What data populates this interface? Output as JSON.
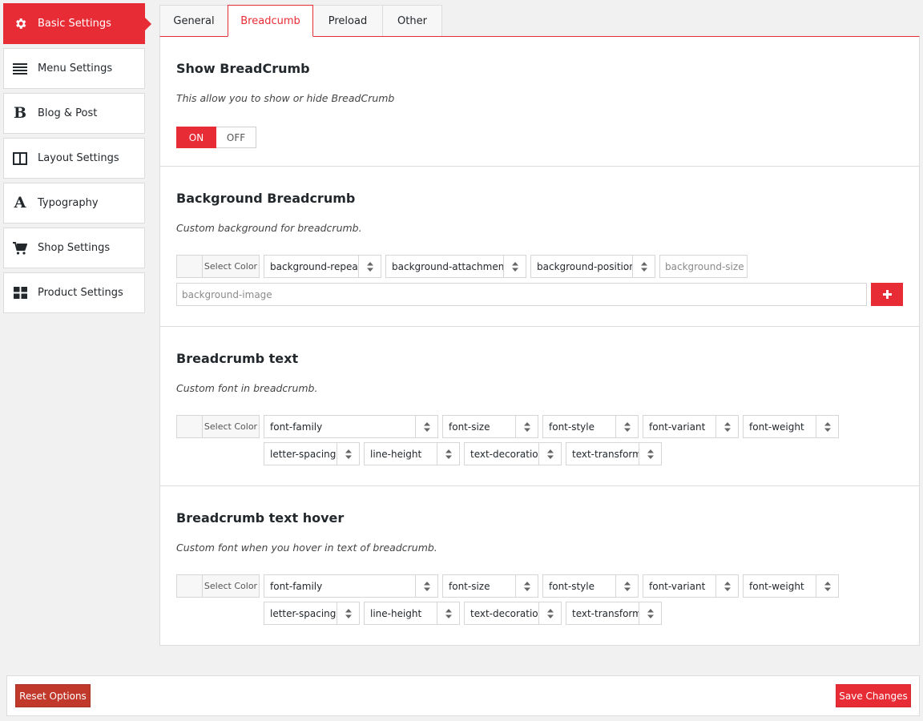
{
  "sidebar": {
    "items": [
      {
        "label": "Basic Settings",
        "icon": "gear-icon",
        "active": true
      },
      {
        "label": "Menu Settings",
        "icon": "menu-lines-icon"
      },
      {
        "label": "Blog & Post",
        "icon": "bold-b-icon",
        "glyph": "B"
      },
      {
        "label": "Layout Settings",
        "icon": "columns-icon"
      },
      {
        "label": "Typography",
        "icon": "font-a-icon",
        "glyph": "A"
      },
      {
        "label": "Shop Settings",
        "icon": "cart-icon"
      },
      {
        "label": "Product Settings",
        "icon": "grid-icon"
      }
    ]
  },
  "tabs": [
    {
      "label": "General"
    },
    {
      "label": "Breadcumb",
      "active": true
    },
    {
      "label": "Preload"
    },
    {
      "label": "Other"
    }
  ],
  "sections": {
    "show": {
      "title": "Show BreadCrumb",
      "desc": "This allow you to show or hide BreadCrumb",
      "on_label": "ON",
      "off_label": "OFF"
    },
    "background": {
      "title": "Background Breadcrumb",
      "desc": "Custom background for breadcrumb.",
      "color_label": "Select Color",
      "repeat": "background-repeat",
      "attachment": "background-attachment",
      "position": "background-position",
      "size_placeholder": "background-size",
      "image_placeholder": "background-image"
    },
    "text": {
      "title": "Breadcrumb text",
      "desc": "Custom font in breadcrumb.",
      "color_label": "Select Color",
      "font_family": "font-family",
      "font_size": "font-size",
      "font_style": "font-style",
      "font_variant": "font-variant",
      "font_weight": "font-weight",
      "letter_spacing": "letter-spacing",
      "line_height": "line-height",
      "text_decoration": "text-decoration",
      "text_transform": "text-transform"
    },
    "hover": {
      "title": "Breadcrumb text hover",
      "desc": "Custom font when you hover in text of breadcrumb.",
      "color_label": "Select Color",
      "font_family": "font-family",
      "font_size": "font-size",
      "font_style": "font-style",
      "font_variant": "font-variant",
      "font_weight": "font-weight",
      "letter_spacing": "letter-spacing",
      "line_height": "line-height",
      "text_decoration": "text-decoration",
      "text_transform": "text-transform"
    }
  },
  "footer": {
    "reset_label": "Reset Options",
    "save_label": "Save Changes"
  },
  "colors": {
    "accent": "#e82c35",
    "reset": "#c0392b",
    "border": "#dcdcdc",
    "background": "#f1f1f1"
  }
}
